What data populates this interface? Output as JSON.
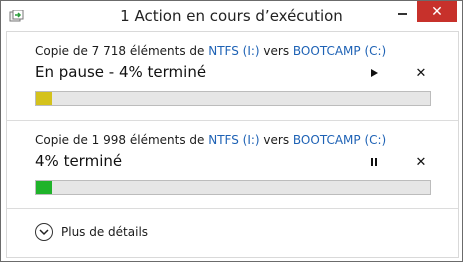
{
  "window": {
    "title": "1 Action en cours d’exécution",
    "minimize_icon": "minimize-icon",
    "close_icon": "close-icon",
    "close_color": "#c7312b"
  },
  "operations": [
    {
      "desc_prefix": "Copie de 7 718 éléments de ",
      "source": "NTFS (I:)",
      "desc_middle": " vers ",
      "destination": "BOOTCAMP (C:)",
      "status": "En pause - 4% terminé",
      "progress": 0.04,
      "progress_color": "#d4c21c",
      "toggle_icon": "play-icon",
      "cancel_icon": "close-icon"
    },
    {
      "desc_prefix": "Copie de 1 998 éléments de ",
      "source": "NTFS (I:)",
      "desc_middle": " vers ",
      "destination": "BOOTCAMP (C:)",
      "status": "4% terminé",
      "progress": 0.04,
      "progress_color": "#1fb32a",
      "toggle_icon": "pause-icon",
      "cancel_icon": "close-icon"
    }
  ],
  "footer": {
    "details_label": "Plus de détails",
    "details_icon": "chevron-down-icon"
  },
  "colors": {
    "link": "#1e62b5",
    "border": "#d9d9d9"
  }
}
